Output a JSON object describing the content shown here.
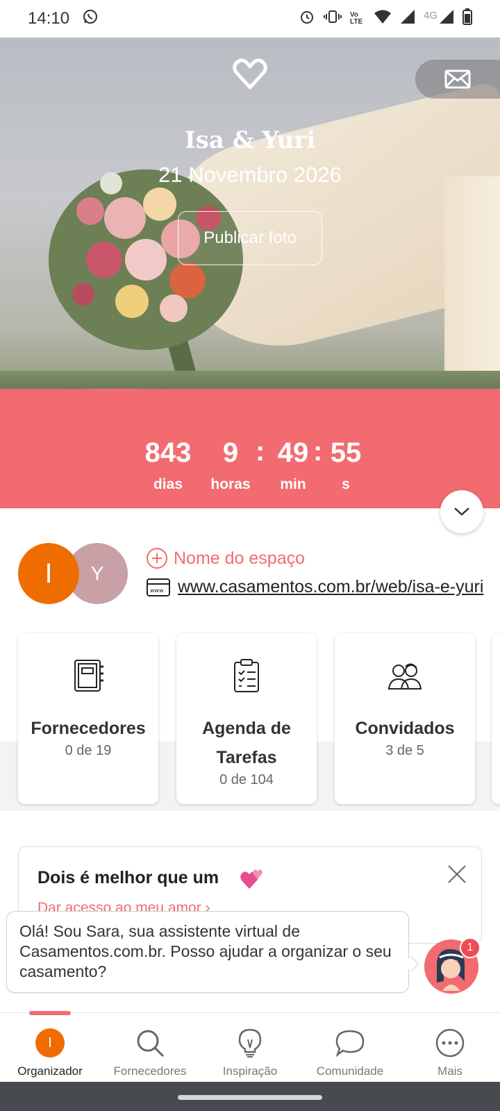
{
  "status_bar": {
    "time": "14:10",
    "icons": [
      "whatsapp-icon",
      "alarm-icon",
      "vibrate-icon",
      "volte-icon",
      "wifi-icon",
      "signal-icon",
      "signal-4g-icon",
      "battery-icon"
    ],
    "network_label": "4G",
    "volte_label": "Vo LTE"
  },
  "hero": {
    "couple_names": "Isa & Yuri",
    "date": "21 Novembro 2026",
    "publish_photo_label": "Publicar foto"
  },
  "countdown": {
    "days": "843",
    "days_label": "dias",
    "hours": "9",
    "hours_label": "horas",
    "minutes": "49",
    "minutes_label": "min",
    "seconds": "55",
    "seconds_label": "s",
    "separator": ":"
  },
  "profile": {
    "avatar_1": "I",
    "avatar_2": "Y",
    "venue_label": "Nome do espaço",
    "website": "www.casamentos.com.br/web/isa-e-yuri"
  },
  "cards": [
    {
      "title": "Fornecedores",
      "subtitle": "0 de 19",
      "icon": "notebook-icon"
    },
    {
      "title": "Agenda de Tarefas",
      "title_line1": "Agenda de",
      "title_line2": "Tarefas",
      "subtitle": "0 de 104",
      "icon": "checklist-icon"
    },
    {
      "title": "Convidados",
      "subtitle": "3 de 5",
      "icon": "guests-icon"
    }
  ],
  "promo": {
    "title": "Dois é melhor que um",
    "link": "Dar acesso ao meu amor"
  },
  "assistant": {
    "message": "Olá! Sou Sara, sua assistente virtual de Casamentos.com.br. Posso ajudar a organizar o seu casamento?",
    "badge_count": "1"
  },
  "bottom_nav": [
    {
      "label": "Organizador",
      "icon": "organizer-avatar-icon",
      "active": true,
      "avatar_letter": "I"
    },
    {
      "label": "Fornecedores",
      "icon": "search-icon",
      "active": false
    },
    {
      "label": "Inspiração",
      "icon": "lightbulb-icon",
      "active": false
    },
    {
      "label": "Comunidade",
      "icon": "chat-bubble-icon",
      "active": false
    },
    {
      "label": "Mais",
      "icon": "more-icon",
      "active": false
    }
  ],
  "colors": {
    "accent": "#f26b70",
    "avatar_orange": "#ef6c00",
    "avatar_mauve": "#c9a0a6"
  }
}
